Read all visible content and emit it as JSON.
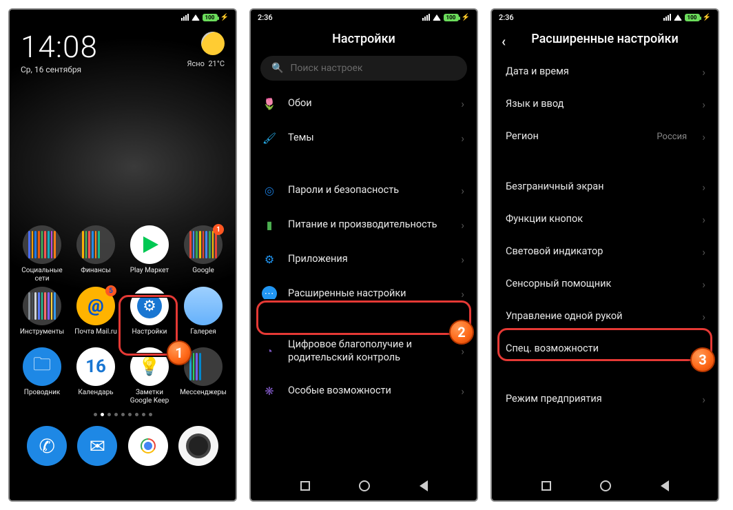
{
  "screen1": {
    "statusbar": {
      "battery": "100"
    },
    "clock": "14:08",
    "date": "Ср, 16 сентября",
    "weather_desc": "Ясно",
    "weather_temp": "21°C",
    "apps_row1": [
      {
        "label": "Социальные сети"
      },
      {
        "label": "Финансы"
      },
      {
        "label": "Play Маркет"
      },
      {
        "label": "Google",
        "badge": "1"
      }
    ],
    "apps_row2": [
      {
        "label": "Инструменты"
      },
      {
        "label": "Почта Mail.ru",
        "badge": "5"
      },
      {
        "label": "Настройки"
      },
      {
        "label": "Галерея"
      }
    ],
    "apps_row3": [
      {
        "label": "Проводник"
      },
      {
        "label": "Календарь",
        "cal_day": "16"
      },
      {
        "label": "Заметки Google Keep"
      },
      {
        "label": "Мессенджеры"
      }
    ],
    "step": "1"
  },
  "screen2": {
    "statusbar": {
      "time": "2:36",
      "battery": "100"
    },
    "title": "Настройки",
    "search_placeholder": "Поиск настроек",
    "items": {
      "wallpaper": "Обои",
      "themes": "Темы",
      "security": "Пароли и безопасность",
      "power": "Питание и производительность",
      "apps": "Приложения",
      "advanced": "Расширенные настройки",
      "dwb": "Цифровое благополучие и родительский контроль",
      "accessibility": "Особые возможности"
    },
    "step": "2"
  },
  "screen3": {
    "statusbar": {
      "time": "2:36",
      "battery": "100"
    },
    "title": "Расширенные настройки",
    "items": {
      "datetime": "Дата и время",
      "lang": "Язык и ввод",
      "region": "Регион",
      "region_value": "Россия",
      "fullscreen": "Безграничный экран",
      "buttons": "Функции кнопок",
      "led": "Световой индикатор",
      "touch_assist": "Сенсорный помощник",
      "one_hand": "Управление одной рукой",
      "special": "Спец. возможности",
      "enterprise": "Режим предприятия"
    },
    "step": "3"
  }
}
